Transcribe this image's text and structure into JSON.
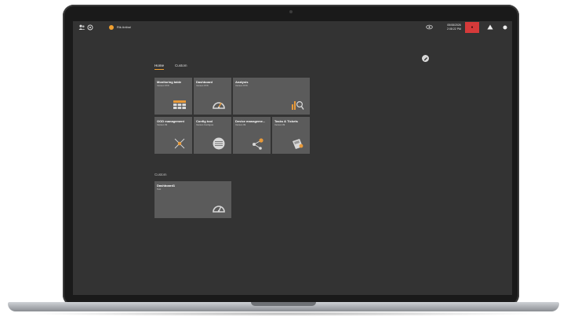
{
  "topbar": {
    "user_name": "Rik Anibal",
    "date": "05/08/2026",
    "time": "2:08:22 PM",
    "icons": [
      "users-icon",
      "settings-icon",
      "eye-icon",
      "alarm-icon",
      "warning-icon",
      "power-icon"
    ]
  },
  "tabs": [
    {
      "label": "Home",
      "active": true
    },
    {
      "label": "Custom",
      "active": false
    }
  ],
  "tiles": [
    {
      "title": "Monitoring table",
      "subtitle": "Version 67/8",
      "icon": "table-icon"
    },
    {
      "title": "Dashboard",
      "subtitle": "Version 67/8",
      "icon": "gauge-icon"
    },
    {
      "title": "Analysis",
      "subtitle": "Version 67/8",
      "icon": "analysis-icon"
    },
    {
      "title": "OOD management",
      "subtitle": "Version 09",
      "icon": "network-icon"
    },
    {
      "title": "Config tool",
      "subtitle": "Version Configure",
      "icon": "config-icon"
    },
    {
      "title": "Device manageme...",
      "subtitle": "Version 09",
      "icon": "device-network-icon"
    },
    {
      "title": "Tasks & Tickets",
      "subtitle": "Version 09",
      "icon": "tasks-icon"
    }
  ],
  "custom_section": {
    "label": "Custom",
    "tiles": [
      {
        "title": "Dashboard1",
        "subtitle": "Test",
        "icon": "gauge-icon"
      }
    ]
  },
  "colors": {
    "accent": "#f0a030",
    "alarm": "#d63a3a",
    "screen_bg": "#333333",
    "tile_bg": "#5b5b5b"
  }
}
